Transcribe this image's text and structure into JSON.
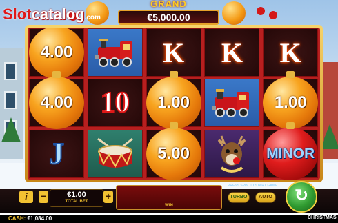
{
  "logo": {
    "prefix": "Slot",
    "suffix": "catalog",
    "tld": ".com"
  },
  "jackpot": {
    "label": "GRAND",
    "value": "€5,000.00"
  },
  "reels": {
    "columns": [
      [
        {
          "type": "orb",
          "color": "orange",
          "text": "4.00"
        },
        {
          "type": "orb",
          "color": "orange",
          "text": "4.00"
        },
        {
          "type": "symbol",
          "symbol": "J"
        }
      ],
      [
        {
          "type": "symbol",
          "symbol": "train"
        },
        {
          "type": "symbol",
          "symbol": "10"
        },
        {
          "type": "symbol",
          "symbol": "drum"
        }
      ],
      [
        {
          "type": "symbol",
          "symbol": "K"
        },
        {
          "type": "orb",
          "color": "orange",
          "text": "1.00"
        },
        {
          "type": "orb",
          "color": "orange",
          "text": "5.00"
        }
      ],
      [
        {
          "type": "symbol",
          "symbol": "K"
        },
        {
          "type": "symbol",
          "symbol": "train"
        },
        {
          "type": "symbol",
          "symbol": "reindeer"
        }
      ],
      [
        {
          "type": "symbol",
          "symbol": "K"
        },
        {
          "type": "orb",
          "color": "orange",
          "text": "1.00"
        },
        {
          "type": "orb",
          "color": "red",
          "text": "MINOR"
        }
      ]
    ]
  },
  "controls": {
    "info_label": "i",
    "minus_label": "−",
    "plus_label": "+",
    "bet_value": "€1.00",
    "bet_label": "TOTAL BET",
    "win_label": "WIN",
    "press_text": "PRESS SPIN TO START GAME",
    "turbo_label": "TURBO",
    "auto_label": "AUTO",
    "spin_icon": "refresh-icon"
  },
  "status": {
    "cash_label": "CASH:",
    "cash_value": "€1,084.00",
    "game_name": "CHRISTMAS"
  },
  "colors": {
    "frame": "#e6b640",
    "reel_bg": "#b71f1f",
    "orb": "#f49a15",
    "spin": "#2f9a30"
  }
}
